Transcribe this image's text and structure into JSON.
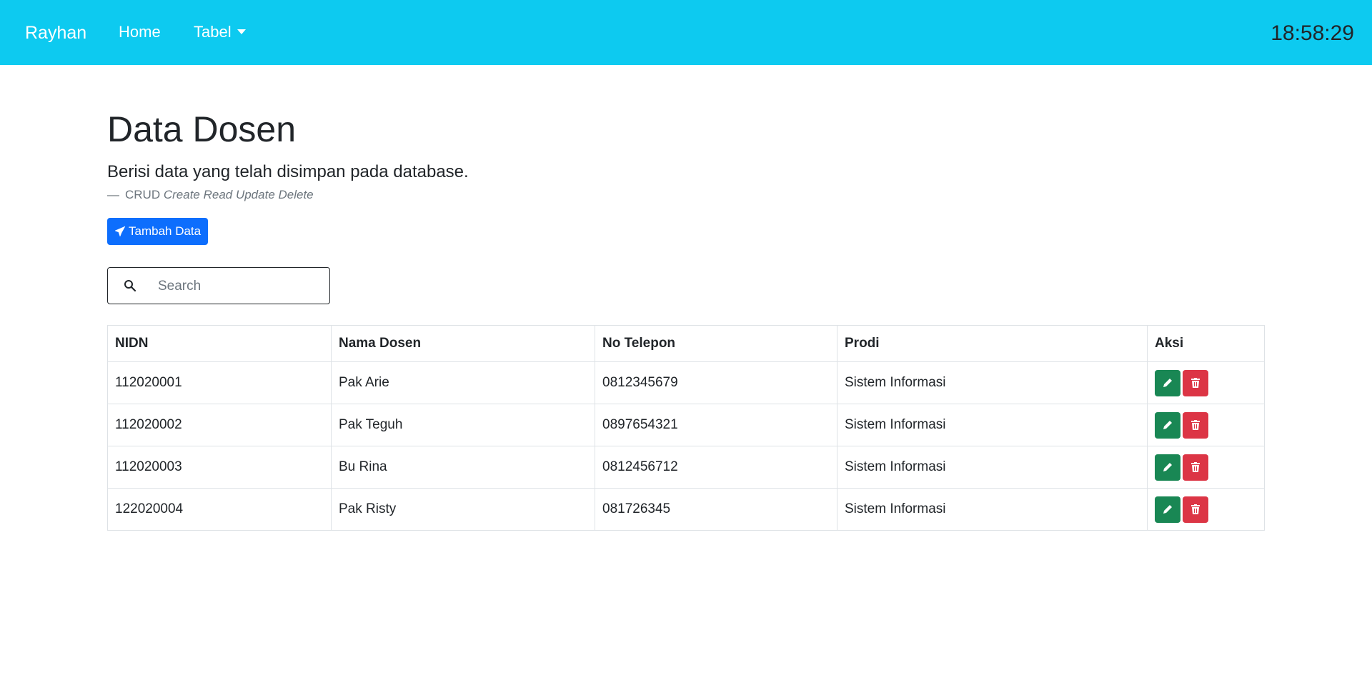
{
  "navbar": {
    "brand": "Rayhan",
    "home_label": "Home",
    "tabel_label": "Tabel",
    "clock": "18:58:29"
  },
  "colors": {
    "navbar_bg": "#0dcaf0",
    "primary": "#0d6efd",
    "success": "#198754",
    "danger": "#dc3545"
  },
  "page": {
    "title": "Data Dosen",
    "lead": "Berisi data yang telah disimpan pada database.",
    "footer_prefix": "CRUD",
    "footer_cite": "Create Read Update Delete",
    "add_button_label": "Tambah Data",
    "add_button_icon": "plane-icon"
  },
  "search": {
    "placeholder": "Search",
    "icon": "search-icon"
  },
  "table": {
    "headers": [
      "NIDN",
      "Nama Dosen",
      "No Telepon",
      "Prodi",
      "Aksi"
    ],
    "rows": [
      {
        "nidn": "112020001",
        "nama": "Pak Arie",
        "telepon": "0812345679",
        "prodi": "Sistem Informasi"
      },
      {
        "nidn": "112020002",
        "nama": "Pak Teguh",
        "telepon": "0897654321",
        "prodi": "Sistem Informasi"
      },
      {
        "nidn": "112020003",
        "nama": "Bu Rina",
        "telepon": "0812456712",
        "prodi": "Sistem Informasi"
      },
      {
        "nidn": "122020004",
        "nama": "Pak Risty",
        "telepon": "081726345",
        "prodi": "Sistem Informasi"
      }
    ],
    "action_icons": [
      "pencil-icon",
      "trash-icon"
    ]
  }
}
